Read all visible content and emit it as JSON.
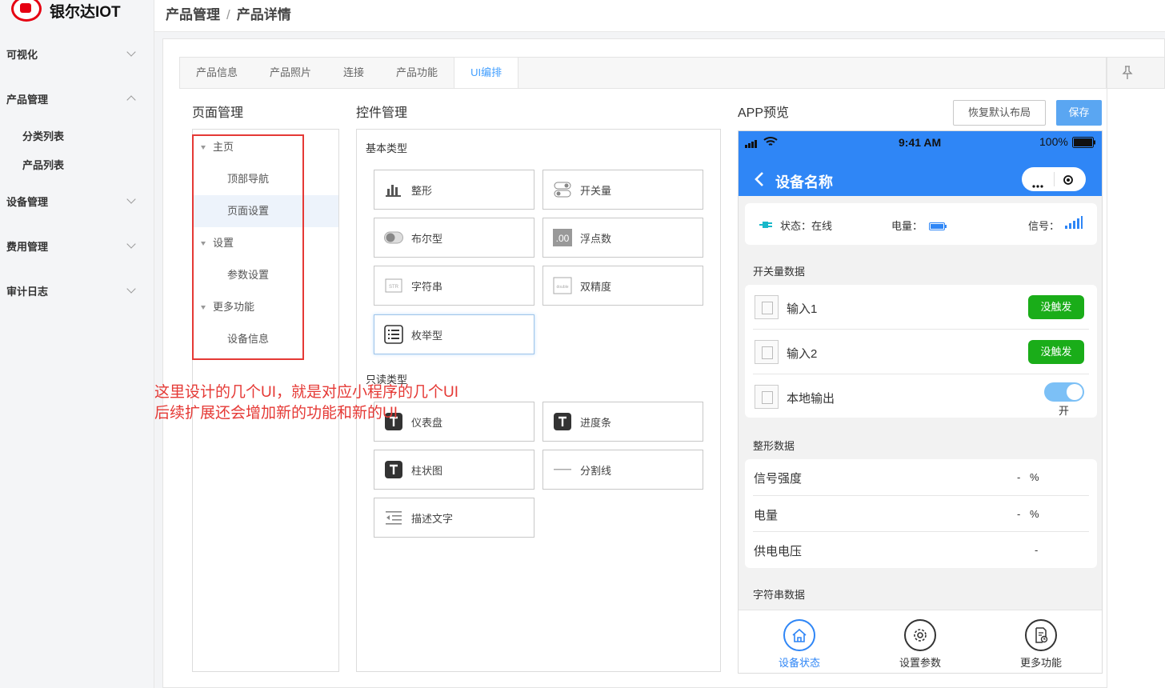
{
  "app": {
    "title": "银尔达IOT"
  },
  "breadcrumb": {
    "parent": "产品管理",
    "separator": "/",
    "current": "产品详情"
  },
  "sidebar": {
    "menus": [
      {
        "label": "可视化",
        "expanded": false
      },
      {
        "label": "产品管理",
        "expanded": true
      },
      {
        "label": "设备管理",
        "expanded": false
      },
      {
        "label": "费用管理",
        "expanded": false
      },
      {
        "label": "审计日志",
        "expanded": false
      }
    ],
    "submenu": [
      "分类列表",
      "产品列表"
    ]
  },
  "tabs": [
    {
      "label": "产品信息",
      "active": false
    },
    {
      "label": "产品照片",
      "active": false
    },
    {
      "label": "连接",
      "active": false
    },
    {
      "label": "产品功能",
      "active": false
    },
    {
      "label": "UI编排",
      "active": true
    }
  ],
  "page_manager": {
    "title": "页面管理",
    "tree": [
      {
        "label": "主页",
        "level": 0,
        "selected": false
      },
      {
        "label": "顶部导航",
        "level": 1,
        "selected": false
      },
      {
        "label": "页面设置",
        "level": 1,
        "selected": true
      },
      {
        "label": "设置",
        "level": 0,
        "selected": false
      },
      {
        "label": "参数设置",
        "level": 1,
        "selected": false
      },
      {
        "label": "更多功能",
        "level": 0,
        "selected": false
      },
      {
        "label": "设备信息",
        "level": 1,
        "selected": false
      }
    ]
  },
  "widget_manager": {
    "title": "控件管理",
    "basic_title": "基本类型",
    "readonly_title": "只读类型",
    "basic": [
      {
        "label": "整形",
        "icon": "bar-chart-icon"
      },
      {
        "label": "开关量",
        "icon": "toggle-icon"
      },
      {
        "label": "布尔型",
        "icon": "switch-icon"
      },
      {
        "label": "浮点数",
        "icon": "decimal-icon"
      },
      {
        "label": "字符串",
        "icon": "string-icon"
      },
      {
        "label": "双精度",
        "icon": "double-icon"
      },
      {
        "label": "枚举型",
        "icon": "list-icon",
        "selected": true
      }
    ],
    "readonly": [
      {
        "label": "仪表盘",
        "icon": "text-t-icon"
      },
      {
        "label": "进度条",
        "icon": "text-t-icon"
      },
      {
        "label": "柱状图",
        "icon": "text-t-icon"
      },
      {
        "label": "分割线",
        "icon": "divider-icon"
      },
      {
        "label": "描述文字",
        "icon": "indent-text-icon"
      }
    ]
  },
  "annotation": {
    "line1": "这里设计的几个UI，就是对应小程序的几个UI",
    "line2": "后续扩展还会增加新的功能和新的UI"
  },
  "preview": {
    "title": "APP预览",
    "restore_label": "恢复默认布局",
    "save_label": "保存",
    "status_bar": {
      "time": "9:41 AM",
      "battery": "100%"
    },
    "nav_title": "设备名称",
    "status_card": {
      "state_label": "状态：在线",
      "power_label": "电量：",
      "signal_label": "信号："
    },
    "switch_section": {
      "title": "开关量数据",
      "rows": [
        {
          "label": "输入1",
          "action": "没触发"
        },
        {
          "label": "输入2",
          "action": "没触发"
        },
        {
          "label": "本地输出",
          "toggle_text": "开"
        }
      ]
    },
    "int_section": {
      "title": "整形数据",
      "rows": [
        {
          "label": "信号强度",
          "value": "-",
          "unit": "%"
        },
        {
          "label": "电量",
          "value": "-",
          "unit": "%"
        },
        {
          "label": "供电电压",
          "value": "-",
          "unit": ""
        }
      ]
    },
    "string_section": {
      "title": "字符串数据"
    },
    "bottom_nav": [
      {
        "label": "设备状态",
        "icon": "home-icon",
        "active": true
      },
      {
        "label": "设置参数",
        "icon": "gear-icon",
        "active": false
      },
      {
        "label": "更多功能",
        "icon": "document-icon",
        "active": false
      }
    ],
    "colors": {
      "primary": "#2f86f6",
      "trigger_button": "#1aad19",
      "annotation": "#e53935"
    }
  }
}
